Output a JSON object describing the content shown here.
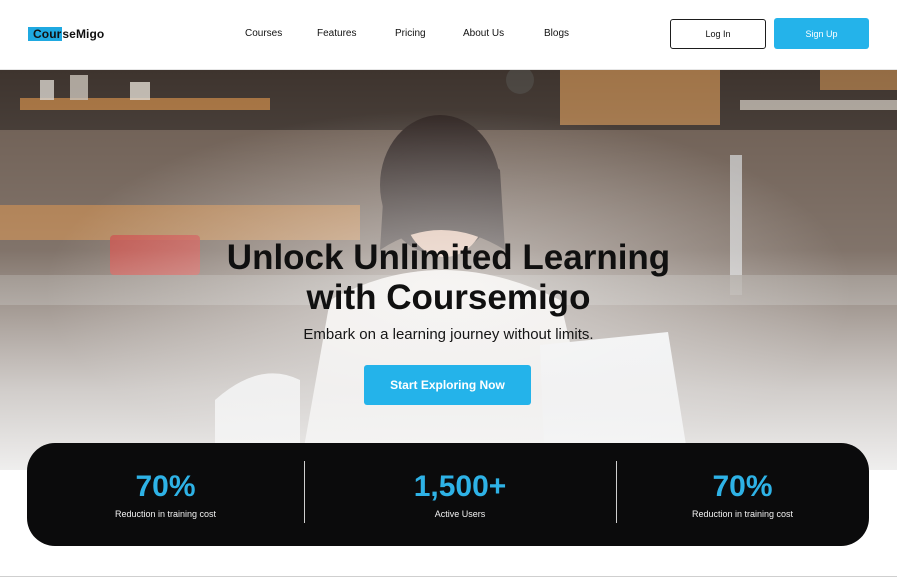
{
  "header": {
    "logo_highlight": "Cour",
    "logo_rest": "seMigo",
    "nav": [
      "Courses",
      "Features",
      "Pricing",
      "About Us",
      "Blogs"
    ],
    "login_label": "Log In",
    "signup_label": "Sign Up"
  },
  "hero": {
    "title_line1": "Unlock Unlimited Learning",
    "title_line2": "with Coursemigo",
    "subtitle": "Embark on a learning journey without limits.",
    "cta_label": "Start Exploring Now"
  },
  "stats": [
    {
      "value": "70%",
      "label": "Reduction in training cost"
    },
    {
      "value": "1,500+",
      "label": "Active Users"
    },
    {
      "value": "70%",
      "label": "Reduction in training cost"
    }
  ],
  "colors": {
    "accent": "#24b3ea",
    "stats_bg": "#0b0b0c",
    "stat_value": "#2eb2e6"
  }
}
